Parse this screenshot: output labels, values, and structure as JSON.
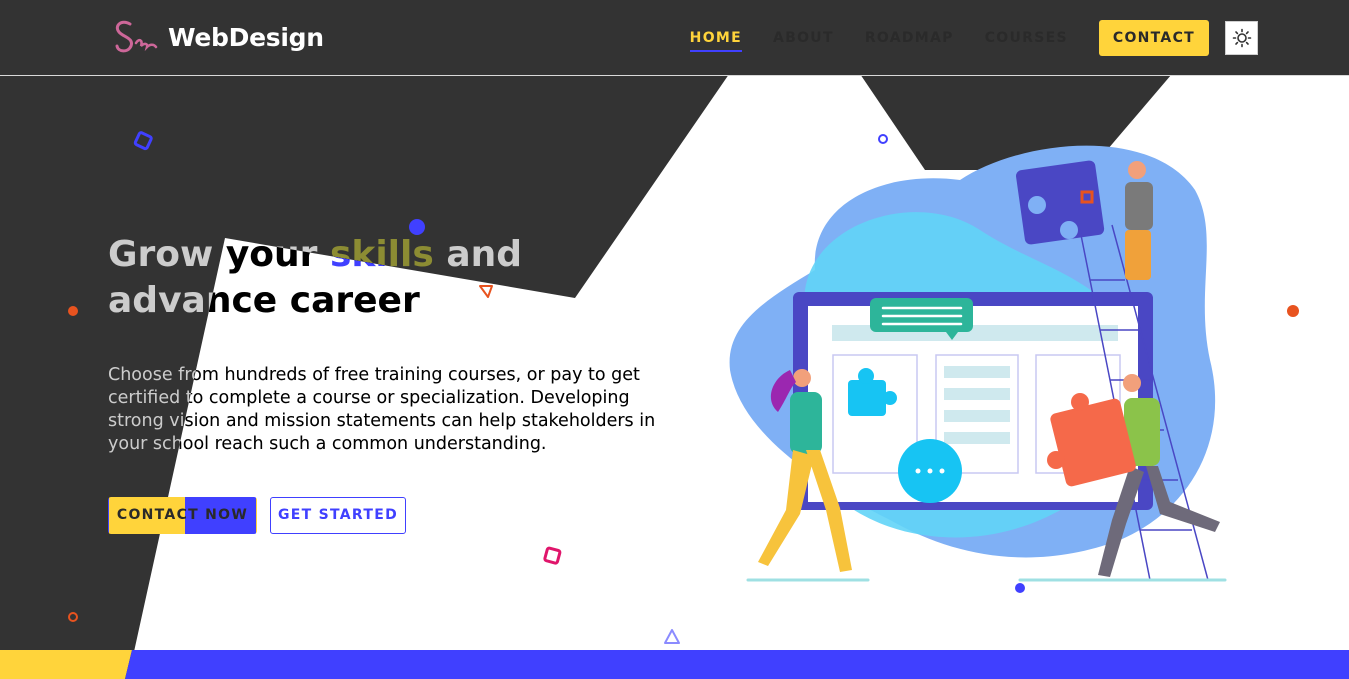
{
  "brand": {
    "logo_script": "Sass",
    "name": "WebDesign",
    "logo_color": "#cd6799"
  },
  "nav": {
    "items": [
      {
        "label": "HOME",
        "active": true
      },
      {
        "label": "ABOUT"
      },
      {
        "label": "ROADMAP"
      },
      {
        "label": "COURSES"
      }
    ],
    "contact_label": "CONTACT",
    "theme_toggle_icon": "sun-icon"
  },
  "hero": {
    "title_before": "Grow your ",
    "title_highlight": "skills",
    "title_after": " and advance career",
    "description": "Choose from hundreds of free training courses, or pay to get certified to complete a course or specialization. Developing strong vision and mission statements can help stakeholders in your school reach such a common understanding.",
    "primary_button": "CONTACT NOW",
    "secondary_button": "GET STARTED"
  },
  "colors": {
    "dark": "#333333",
    "accent_yellow": "#ffd43b",
    "accent_blue": "#4040ff",
    "accent_orange": "#e8531f",
    "accent_pink": "#e0156b"
  }
}
